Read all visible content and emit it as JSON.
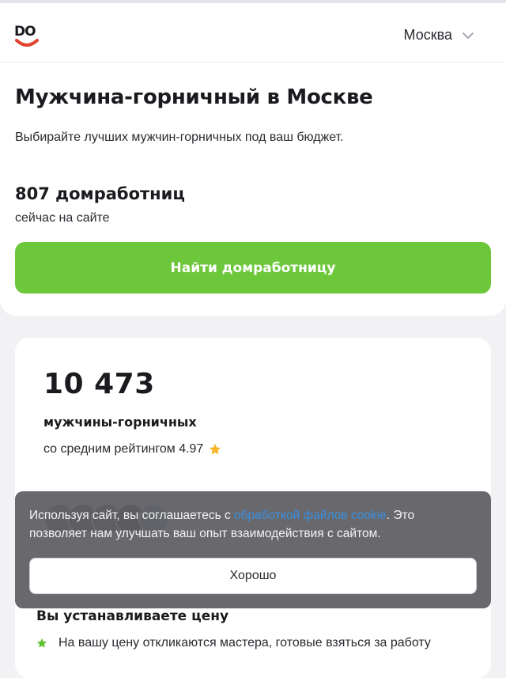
{
  "header": {
    "logo_text": "DO",
    "city": "Москва",
    "logo_accent": "#e0442f"
  },
  "hero": {
    "title": "Мужчина-горничный в Москве",
    "subtitle": "Выбирайте лучших мужчин-горничных под ваш бюджет.",
    "count": "807 домработниц",
    "count_sub": "сейчас на сайте",
    "cta": "Найти домработницу",
    "cta_color": "#6cc83a"
  },
  "stats": {
    "number": "10 473",
    "label": "мужчины-горничных",
    "rating_text": "со средним рейтингом 4.97",
    "rating_icon": "star-icon"
  },
  "price": {
    "title": "Вы устанавливаете цену",
    "feature": "На вашу цену откликаются мастера, готовые взяться за работу"
  },
  "cookie": {
    "text_before": "Используя сайт, вы соглашаетесь с ",
    "link": "обработкой файлов cookie",
    "text_after": ". Это позволяет нам улучшать ваш опыт взаимодействия с сайтом.",
    "button": "Хорошо"
  }
}
